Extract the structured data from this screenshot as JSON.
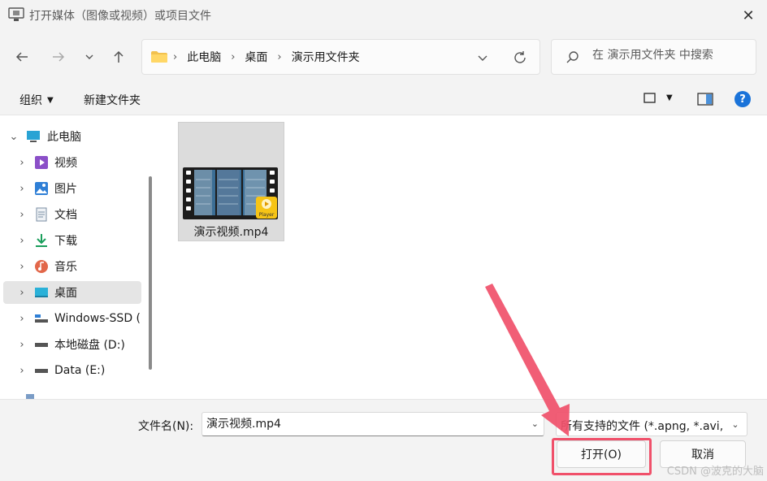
{
  "window": {
    "title": "打开媒体（图像或视频）或项目文件",
    "close_icon": "close-icon"
  },
  "nav": {
    "back_icon": "arrow-left-icon",
    "forward_icon": "arrow-right-icon",
    "recent_icon": "chevron-down-icon",
    "up_icon": "arrow-up-icon"
  },
  "address": {
    "crumbs": [
      "此电脑",
      "桌面",
      "演示用文件夹"
    ],
    "dropdown_icon": "chevron-down-icon",
    "refresh_icon": "refresh-icon"
  },
  "search": {
    "placeholder": "在 演示用文件夹 中搜索"
  },
  "toolbar": {
    "organize_label": "组织",
    "new_folder_label": "新建文件夹",
    "help_label": "?"
  },
  "sidebar": {
    "items": [
      {
        "label": "此电脑",
        "icon": "computer-icon",
        "expanded": true
      },
      {
        "label": "视频",
        "icon": "video-folder-icon"
      },
      {
        "label": "图片",
        "icon": "pictures-folder-icon"
      },
      {
        "label": "文档",
        "icon": "documents-folder-icon"
      },
      {
        "label": "下载",
        "icon": "download-icon"
      },
      {
        "label": "音乐",
        "icon": "music-icon"
      },
      {
        "label": "桌面",
        "icon": "desktop-icon",
        "selected": true
      },
      {
        "label": "Windows-SSD (",
        "icon": "drive-icon"
      },
      {
        "label": "本地磁盘 (D:)",
        "icon": "drive-icon"
      },
      {
        "label": "Data (E:)",
        "icon": "drive-icon"
      }
    ]
  },
  "content": {
    "files": [
      {
        "name": "演示视频.mp4",
        "icon": "video-file-thumbnail",
        "badge": "Player"
      }
    ]
  },
  "footer": {
    "filename_label": "文件名(N):",
    "filename_value": "演示视频.mp4",
    "filetype_value": "所有支持的文件 (*.apng, *.avi,",
    "open_label": "打开(O)",
    "cancel_label": "取消"
  },
  "watermark": "CSDN @波克的大脑",
  "colors": {
    "accent": "#1a73d9",
    "annotation": "#f0506a",
    "selection": "#e5e5e5",
    "chrome": "#f3f3f3"
  }
}
